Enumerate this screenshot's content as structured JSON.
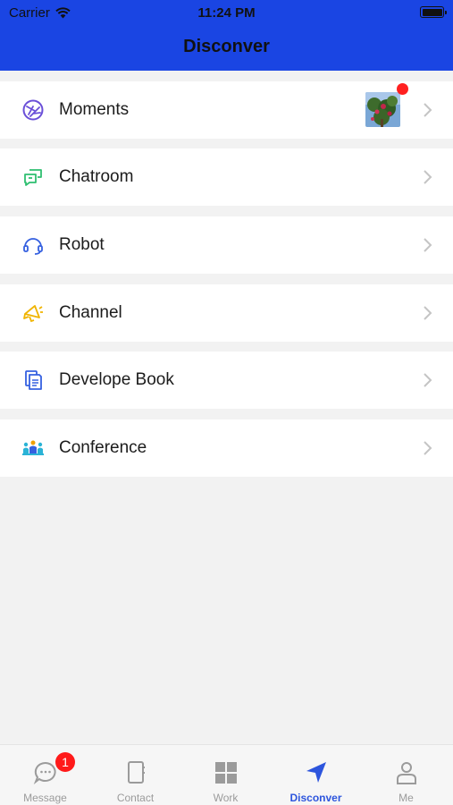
{
  "status_bar": {
    "carrier": "Carrier",
    "time": "11:24 PM"
  },
  "header": {
    "title": "Disconver"
  },
  "items": [
    {
      "label": "Moments",
      "icon": "moments-icon",
      "color": "#6a4fd8"
    },
    {
      "label": "Chatroom",
      "icon": "chatroom-icon",
      "color": "#2fbf71"
    },
    {
      "label": "Robot",
      "icon": "robot-icon",
      "color": "#3560e0"
    },
    {
      "label": "Channel",
      "icon": "channel-icon",
      "color": "#f0b400"
    },
    {
      "label": "Develope Book",
      "icon": "book-icon",
      "color": "#3560e0"
    },
    {
      "label": "Conference",
      "icon": "conference-icon",
      "color": "#2bb3d6"
    }
  ],
  "tabs": [
    {
      "label": "Message",
      "icon": "message-icon",
      "badge": "1"
    },
    {
      "label": "Contact",
      "icon": "contact-icon"
    },
    {
      "label": "Work",
      "icon": "work-icon"
    },
    {
      "label": "Disconver",
      "icon": "navigation-icon",
      "active": true
    },
    {
      "label": "Me",
      "icon": "person-icon"
    }
  ],
  "colors": {
    "header_bg": "#1a45e3",
    "active_tab": "#2d55dd",
    "badge": "#ff1a1a"
  }
}
